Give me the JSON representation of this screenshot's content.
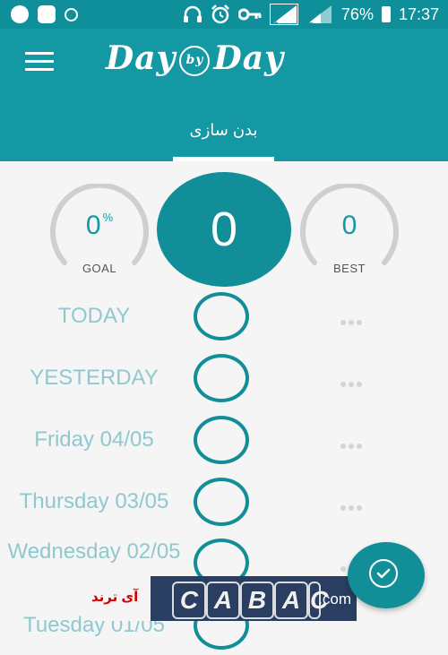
{
  "status_bar": {
    "battery": "76%",
    "time": "17:37",
    "sim_indicator_1": "1",
    "sim_indicator_2": "2",
    "left_icons": [
      "whatsapp-icon",
      "shield-icon",
      "ring-icon"
    ],
    "right_icons": [
      "headphones-icon",
      "alarm-icon",
      "key-icon",
      "signal-icon",
      "signal-icon",
      "battery-icon"
    ]
  },
  "header": {
    "logo_left": "Day",
    "logo_middle": "by",
    "logo_right": "Day",
    "active_tab": "بدن سازی",
    "menu_icon": "hamburger-menu-icon"
  },
  "stats": {
    "goal": {
      "value": "0",
      "unit": "%",
      "label": "GOAL"
    },
    "count": "0",
    "best": {
      "value": "0",
      "label": "BEST"
    }
  },
  "days": [
    {
      "label": "TODAY"
    },
    {
      "label": "YESTERDAY"
    },
    {
      "label": "Friday 04/05"
    },
    {
      "label": "Thursday 03/05"
    },
    {
      "label": "Wednesday 02/05"
    },
    {
      "label": "Tuesday 01/05"
    }
  ],
  "fab": {
    "icon": "check-circle-icon"
  },
  "watermark": {
    "left_text": "آی ترند",
    "marks": [
      "C",
      "A",
      "B",
      "A",
      "C"
    ],
    "right_text": ".com"
  },
  "colors": {
    "primary": "#1499a4",
    "primary_dark": "#128e99",
    "status_bar": "#0f8f9a",
    "day_label": "#8fc9cf",
    "background": "#f5f5f5"
  }
}
